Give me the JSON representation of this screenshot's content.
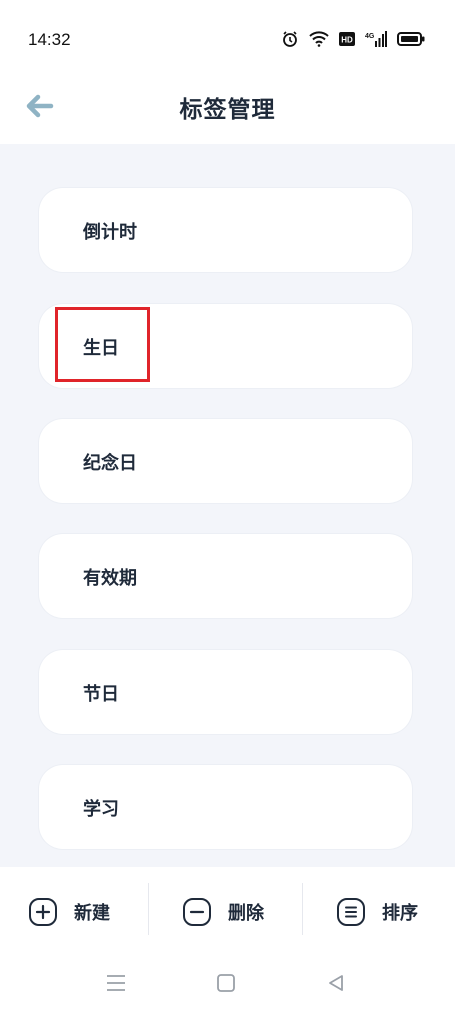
{
  "status_bar": {
    "time": "14:32",
    "icons": [
      "alarm-icon",
      "wifi-icon",
      "hd-icon",
      "signal-4g-icon",
      "battery-icon"
    ],
    "hd_text": "HD",
    "network_text": "4G"
  },
  "header": {
    "title": "标签管理",
    "back_icon": "back-arrow-icon"
  },
  "tags": [
    {
      "label": "倒计时"
    },
    {
      "label": "生日"
    },
    {
      "label": "纪念日"
    },
    {
      "label": "有效期"
    },
    {
      "label": "节日"
    },
    {
      "label": "学习"
    }
  ],
  "bottom_actions": {
    "new_label": "新建",
    "delete_label": "删除",
    "sort_label": "排序"
  },
  "nav": {
    "icons": [
      "menu-icon",
      "home-icon",
      "back-icon"
    ]
  },
  "colors": {
    "accent": "#8fb3c4",
    "highlight": "#e0242a",
    "background": "#f3f5fa",
    "text": "#1f2a3a"
  }
}
